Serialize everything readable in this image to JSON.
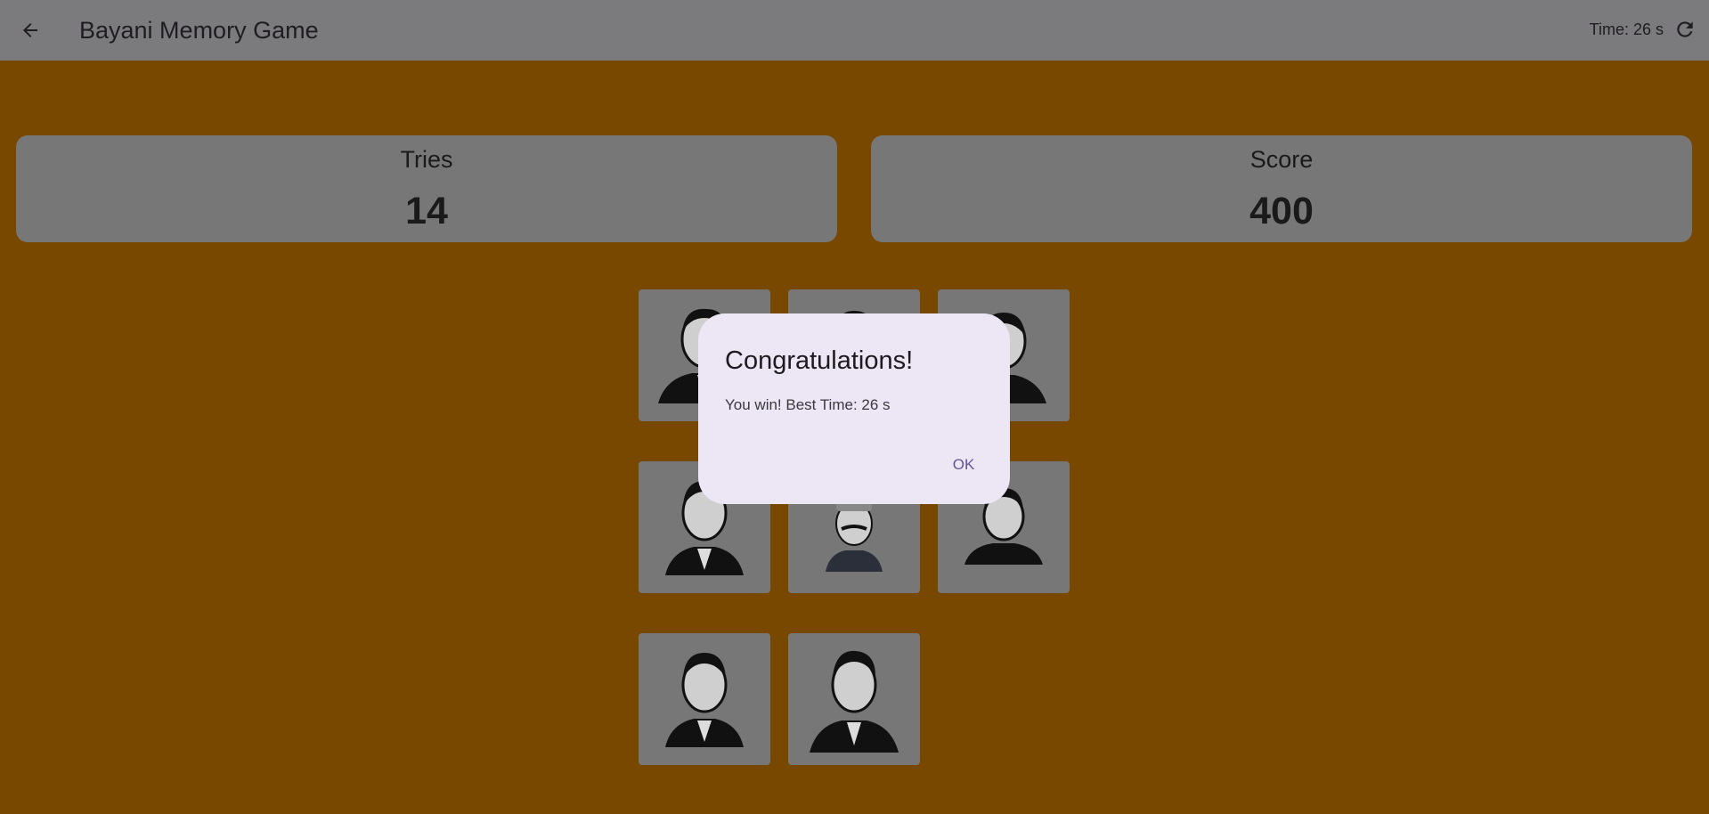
{
  "app_bar": {
    "back_icon": "arrow-back-icon",
    "title": "Bayani Memory Game",
    "timer": "Time: 26 s",
    "refresh_icon": "refresh-icon"
  },
  "stats": {
    "tries_label": "Tries",
    "tries_value": "14",
    "score_label": "Score",
    "score_value": "400"
  },
  "cards": [
    {
      "state": "face-up",
      "portrait": "hero-portrait-1"
    },
    {
      "state": "face-up",
      "portrait": "hero-portrait-2"
    },
    {
      "state": "face-up",
      "portrait": "hero-portrait-3"
    },
    {
      "state": "face-up",
      "portrait": "hero-portrait-4"
    },
    {
      "state": "face-up",
      "portrait": "hero-portrait-5"
    },
    {
      "state": "face-up",
      "portrait": "hero-portrait-6"
    },
    {
      "state": "face-up",
      "portrait": "hero-portrait-7"
    },
    {
      "state": "face-up",
      "portrait": "hero-portrait-8"
    }
  ],
  "dialog": {
    "title": "Congratulations!",
    "message": "You win! Best Time: 26 s",
    "ok_label": "OK"
  },
  "colors": {
    "background": "#794800",
    "app_bar": "#7b7a7d",
    "card": "#777777",
    "dialog": "#ede6f5",
    "dialog_action": "#64558f"
  }
}
